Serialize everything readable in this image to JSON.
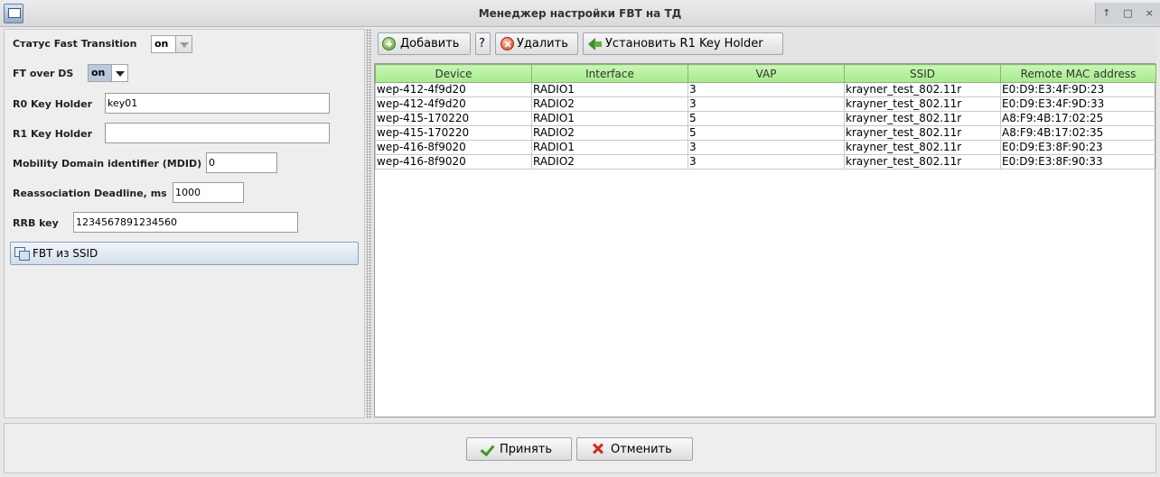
{
  "window": {
    "title": "Менеджер настройки FBT на ТД",
    "controls": [
      "↑",
      "□",
      "×"
    ]
  },
  "form": {
    "fast_transition_label": "Статус Fast Transition",
    "fast_transition_value": "on",
    "ft_over_ds_label": "FT over DS",
    "ft_over_ds_value": "on",
    "r0_key_holder_label": "R0 Key Holder",
    "r0_key_holder_value": "key01",
    "r1_key_holder_label": "R1 Key Holder",
    "r1_key_holder_value": "",
    "mdid_label": "Mobility Domain identifier (MDID)",
    "mdid_value": "0",
    "reassoc_label": "Reassociation Deadline, ms",
    "reassoc_value": "1000",
    "rrb_label": "RRB key",
    "rrb_value": "1234567891234560",
    "fbt_from_ssid_label": "FBT из SSID"
  },
  "toolbar": {
    "add_label": "Добавить",
    "help_label": "?",
    "delete_label": "Удалить",
    "set_r1_label": "Установить R1 Key Holder"
  },
  "table": {
    "columns": [
      "Device",
      "Interface",
      "VAP",
      "SSID",
      "Remote MAC address"
    ],
    "rows": [
      [
        "wep-412-4f9d20",
        "RADIO1",
        "3",
        "krayner_test_802.11r",
        "E0:D9:E3:4F:9D:23"
      ],
      [
        "wep-412-4f9d20",
        "RADIO2",
        "3",
        "krayner_test_802.11r",
        "E0:D9:E3:4F:9D:33"
      ],
      [
        "wep-415-170220",
        "RADIO1",
        "5",
        "krayner_test_802.11r",
        "A8:F9:4B:17:02:25"
      ],
      [
        "wep-415-170220",
        "RADIO2",
        "5",
        "krayner_test_802.11r",
        "A8:F9:4B:17:02:35"
      ],
      [
        "wep-416-8f9020",
        "RADIO1",
        "3",
        "krayner_test_802.11r",
        "E0:D9:E3:8F:90:23"
      ],
      [
        "wep-416-8f9020",
        "RADIO2",
        "3",
        "krayner_test_802.11r",
        "E0:D9:E3:8F:90:33"
      ]
    ]
  },
  "dialog": {
    "accept_label": "Принять",
    "cancel_label": "Отменить"
  },
  "colors": {
    "table_header": "#b5f09c",
    "accent": "#3d9a24",
    "danger": "#d42a1a"
  },
  "icons": {
    "add": "plus-circle-icon",
    "delete": "delete-circle-icon",
    "set_r1": "arrow-left-icon",
    "accept": "check-icon",
    "cancel": "x-icon",
    "fbt_from_ssid": "copy-icon"
  }
}
